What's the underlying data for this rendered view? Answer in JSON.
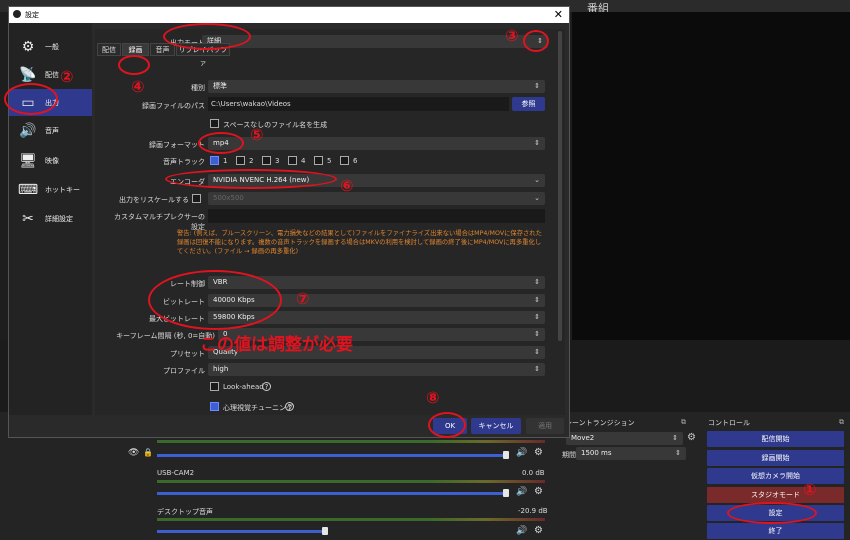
{
  "main_window": {
    "title": "番組",
    "transition_dock": {
      "header": "シーントランジション",
      "transition": "Move2",
      "duration_label": "期間",
      "duration": "1500 ms"
    },
    "controls": {
      "header": "コントロール",
      "buttons": [
        "配信開始",
        "録画開始",
        "仮想カメラ開始",
        "スタジオモード",
        "設定",
        "終了"
      ]
    },
    "mixer": [
      {
        "name": "",
        "level": ""
      },
      {
        "name": "USB-CAM2",
        "level": "0.0 dB"
      },
      {
        "name": "デスクトップ音声",
        "level": "-20.9 dB"
      }
    ],
    "colors": {
      "accent": "#2f3a8f",
      "studio": "#7a2a2a",
      "annotation": "#e0131f"
    }
  },
  "dialog": {
    "title": "設定",
    "close": "✕",
    "sidebar": [
      {
        "label": "一般",
        "icon": "gear-icon"
      },
      {
        "label": "配信",
        "icon": "antenna-icon"
      },
      {
        "label": "出力",
        "icon": "output-icon"
      },
      {
        "label": "音声",
        "icon": "speaker-icon"
      },
      {
        "label": "映像",
        "icon": "monitor-icon"
      },
      {
        "label": "ホットキー",
        "icon": "keyboard-icon"
      },
      {
        "label": "詳細設定",
        "icon": "tools-icon"
      }
    ],
    "output_mode_label": "出力モード",
    "output_mode_value": "詳細",
    "tabs": [
      "配信",
      "録画",
      "音声",
      "リプレイバッファ"
    ],
    "type_label": "種別",
    "type_value": "標準",
    "path_label": "録画ファイルのパス",
    "path_value": "C:\\Users\\wakao\\Videos",
    "browse_label": "参照",
    "nospace_label": "スペースなしのファイル名を生成",
    "format_label": "録画フォーマット",
    "format_value": "mp4",
    "tracks_label": "音声トラック",
    "tracks": [
      "1",
      "2",
      "3",
      "4",
      "5",
      "6"
    ],
    "encoder_label": "エンコーダ",
    "encoder_value": "NVIDIA NVENC H.264 (new)",
    "rescale_label": "出力をリスケールする",
    "rescale_value": "500x500",
    "muxer_label": "カスタムマルチプレクサーの設定",
    "warning": "警告: (例えば、ブルースクリーン、電力損失などの結果として)ファイルをファイナライズ出来ない場合はMP4/MOVに保存された録画は回復不能になります。複数の音声トラックを録画する場合はMKVの利用を検討して録画の終了後にMP4/MOVに再多重化してください。(ファイル → 録画の再多重化)",
    "rate_control_label": "レート制御",
    "rate_control_value": "VBR",
    "bitrate_label": "ビットレート",
    "bitrate_value": "40000 Kbps",
    "max_bitrate_label": "最大ビットレート",
    "max_bitrate_value": "59800 Kbps",
    "keyframe_label": "キーフレーム間隔 (秒, 0=自動)",
    "keyframe_value": "0",
    "preset_label": "プリセット",
    "preset_value": "Quality",
    "profile_label": "プロファイル",
    "profile_value": "high",
    "lookahead_label": "Look-ahead",
    "psycho_label": "心理視覚チューニング",
    "ok_label": "OK",
    "cancel_label": "キャンセル",
    "apply_label": "適用"
  },
  "annotations": {
    "numbers": [
      "①",
      "②",
      "③",
      "④",
      "⑤",
      "⑥",
      "⑦",
      "⑧"
    ],
    "note": "この値は調整が必要"
  }
}
